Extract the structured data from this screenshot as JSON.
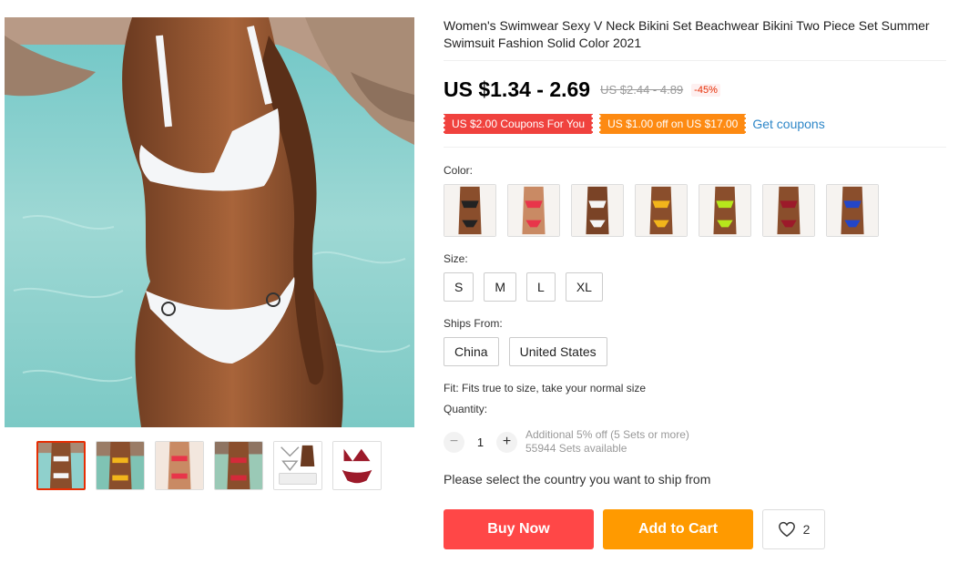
{
  "product": {
    "title": "Women's Swimwear Sexy V Neck Bikini Set Beachwear Bikini Two Piece Set Summer Swimsuit Fashion Solid Color 2021",
    "price": "US $1.34 - 2.69",
    "original_price": "US $2.44 - 4.89",
    "discount": "-45%"
  },
  "coupons": {
    "coupon_1": "US $2.00 Coupons For You",
    "coupon_2": "US $1.00 off on US $17.00",
    "get_coupons": "Get coupons"
  },
  "color": {
    "label": "Color:",
    "options": [
      {
        "name": "black",
        "hex": "#222222"
      },
      {
        "name": "red",
        "hex": "#e8354a"
      },
      {
        "name": "white",
        "hex": "#f5f5f5"
      },
      {
        "name": "yellow",
        "hex": "#f2b51b"
      },
      {
        "name": "neon-green",
        "hex": "#b7e61c"
      },
      {
        "name": "burgundy",
        "hex": "#9c1a2a"
      },
      {
        "name": "blue",
        "hex": "#2346c8"
      }
    ]
  },
  "size": {
    "label": "Size:",
    "options": [
      "S",
      "M",
      "L",
      "XL"
    ]
  },
  "ships_from": {
    "label": "Ships From:",
    "options": [
      "China",
      "United States"
    ]
  },
  "fit_note": "Fit: Fits true to size, take your normal size",
  "quantity": {
    "label": "Quantity:",
    "minus": "−",
    "plus": "+",
    "value": "1",
    "additional": "Additional 5% off (5 Sets or more)",
    "available": "55944 Sets available"
  },
  "ship_note": "Please select the country you want to ship from",
  "actions": {
    "buy_now": "Buy Now",
    "add_to_cart": "Add to Cart",
    "wishlist_count": "2"
  },
  "icons": {
    "wishlist": "heart-icon"
  },
  "colors": {
    "buy_now": "#ff4747",
    "add_to_cart": "#ff9a00",
    "coupon_red": "#f0423e",
    "coupon_orange": "#fd8a12",
    "link": "#2e87c8"
  }
}
